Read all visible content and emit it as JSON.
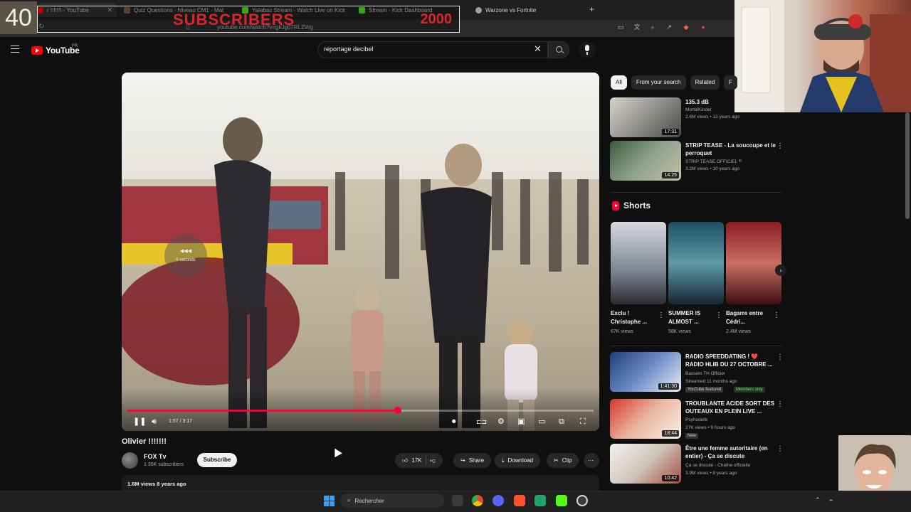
{
  "browser": {
    "tabs": [
      {
        "label": "r !!!!!!! - YouTube",
        "active": true,
        "color": "#ff0000"
      },
      {
        "label": "Quiz Questions - Niveau CM1 - Mat",
        "color": "#8a5a44"
      },
      {
        "label": "Yalabac Stream - Watch Live on Kick",
        "color": "#53fc18"
      },
      {
        "label": "Stream - Kick Dashboard",
        "color": "#53fc18"
      },
      {
        "label": "Warzone vs Fortnite",
        "color": "#9aa0a6"
      }
    ],
    "url": "youtube.com/watch?v=gkJg07RLZWg"
  },
  "overlay": {
    "counter": "40",
    "subscribers_label": "SUBSCRIBERS",
    "subscribers_goal": "2000"
  },
  "youtube": {
    "logo": "YouTube",
    "region": "FR",
    "search_query": "reportage decibel"
  },
  "player": {
    "progress": 0.58,
    "time": "1:57 / 3:17",
    "skip_hint": "5 seconds",
    "skip_arrows": "◂◂◂"
  },
  "video": {
    "title": "Olivier !!!!!!!",
    "channel": "FOX Tv",
    "subscribers": "1.35K subscribers",
    "subscribe_label": "Subscribe",
    "likes": "17K",
    "share_label": "Share",
    "download_label": "Download",
    "clip_label": "Clip",
    "views_date": "1.6M views  8 years ago"
  },
  "rail": {
    "chips": [
      "All",
      "From your search",
      "Related",
      "F"
    ],
    "top_recs": [
      {
        "title": "135.3 dB",
        "channel": "MortalKinder",
        "meta": "2.6M views • 13 years ago",
        "duration": "17:31"
      },
      {
        "title": "STRIP TEASE - La soucoupe et le perroquet",
        "channel": "STRIP TEASE OFFICIEL ᶠᴿ",
        "meta": "3.2M views • 10 years ago",
        "duration": "14:25"
      }
    ],
    "shorts_label": "Shorts",
    "shorts": [
      {
        "title": "Exclu ! Christophe ...",
        "views": "67K views"
      },
      {
        "title": "SUMMER IS ALMOST ...",
        "views": "58K views"
      },
      {
        "title": "Bagarre entre Cédri...",
        "views": "2.4M views"
      }
    ],
    "bottom_recs": [
      {
        "title": "RADIO SPEEDDATING ! ❤️ RADIO HLIB DU 27 OCTOBRE ...",
        "channel": "Bassem TH Officiel",
        "meta": "Streamed 11 months ago",
        "duration": "1:41:30",
        "badge1": "YouTube featured",
        "badge2": "Members only"
      },
      {
        "title": "TROUBLANTE ACIDE SORT DES OUTEAUX EN PLEIN LIVE ...",
        "channel": "Psyhodelik",
        "meta": "27K views • 9 hours ago",
        "duration": "18:44",
        "badge1": "New"
      },
      {
        "title": "Être une femme autoritaire (en entier) - Ça se discute",
        "channel": "Ça se discute - Chaîne officielle",
        "meta": "3.9M views • 8 years ago",
        "duration": "10:42"
      }
    ]
  },
  "taskbar": {
    "search_label": "Rechercher"
  }
}
